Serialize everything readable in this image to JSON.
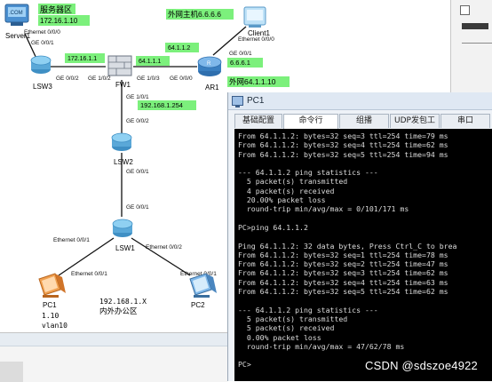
{
  "topology": {
    "server_zone_label": "服务器区",
    "server_ip": "172.16.1.10",
    "server_name": "Server1",
    "server_port": "Ethernet 0/0/0",
    "lsw3_port_up": "GE 0/0/1",
    "lsw3_port_right": "GE 0/0/2",
    "lsw3_name": "LSW3",
    "fw_link_subnet": "172.16.1.1",
    "fw_port_left": "GE 1/0/2",
    "fw_name": "FW1",
    "fw_port_right": "GE 1/0/3",
    "fw_out_ip": "64.1.1.1",
    "fw_port_down": "GE 1/0/1",
    "fw_lan_ip": "192.168.1.254",
    "ar_port_left": "GE 0/0/0",
    "ar_peer_ip": "64.1.1.2",
    "ar_name": "AR1",
    "ar_port_up": "GE 0/0/1",
    "ar_up_ip": "6.6.6.1",
    "external_host_label": "外网主机6.6.6.6",
    "client_name": "Client1",
    "client_port": "Ethernet 0/0/0",
    "external_net_label": "外网64.1.1.10",
    "lsw2_port_up": "GE 0/0/2",
    "lsw2_name": "LSW2",
    "lsw2_port_down": "GE 0/0/1",
    "lsw1_port_up": "GE 0/0/1",
    "lsw1_name": "LSW1",
    "lsw1_port_left": "Ethernet 0/0/1",
    "lsw1_port_right": "Ethernet 0/0/2",
    "pc1_port": "Ethernet 0/0/1",
    "pc2_port": "Ethernet 0/0/1",
    "pc1_name": "PC1",
    "pc2_name": "PC2",
    "office_subnet": "192.168.1.X",
    "office_label": "内外办公区",
    "pc1_ip_suffix": "1.10",
    "pc1_vlan": "vlan10"
  },
  "window": {
    "title": "PC1",
    "tabs": [
      "基础配置",
      "命令行",
      "组播",
      "UDP发包工具",
      "串口"
    ],
    "active_tab": "命令行"
  },
  "console": {
    "lines": [
      "From 64.1.1.2: bytes=32 seq=3 ttl=254 time=79 ms",
      "From 64.1.1.2: bytes=32 seq=4 ttl=254 time=62 ms",
      "From 64.1.1.2: bytes=32 seq=5 ttl=254 time=94 ms",
      "",
      "--- 64.1.1.2 ping statistics ---",
      "  5 packet(s) transmitted",
      "  4 packet(s) received",
      "  20.00% packet loss",
      "  round-trip min/avg/max = 0/101/171 ms",
      "",
      "PC>ping 64.1.1.2",
      "",
      "Ping 64.1.1.2: 32 data bytes, Press Ctrl_C to brea",
      "From 64.1.1.2: bytes=32 seq=1 ttl=254 time=78 ms",
      "From 64.1.1.2: bytes=32 seq=2 ttl=254 time=47 ms",
      "From 64.1.1.2: bytes=32 seq=3 ttl=254 time=62 ms",
      "From 64.1.1.2: bytes=32 seq=4 ttl=254 time=63 ms",
      "From 64.1.1.2: bytes=32 seq=5 ttl=254 time=62 ms",
      "",
      "--- 64.1.1.2 ping statistics ---",
      "  5 packet(s) transmitted",
      "  5 packet(s) received",
      "  0.00% packet loss",
      "  round-trip min/avg/max = 47/62/78 ms",
      "",
      "PC>"
    ]
  },
  "watermark": "CSDN @sdszoe4922",
  "colors": {
    "label_green": "#7cf07c",
    "cable": "#111111",
    "console_bg": "#000000",
    "console_text": "#dcdcdc",
    "switch_blue": "#5aa8d8",
    "pc_orange": "#e8862a",
    "router_blue": "#3a7fc0"
  },
  "icons": [
    "server-icon",
    "switch-icon",
    "firewall-icon",
    "router-icon",
    "client-icon",
    "pc-icon"
  ]
}
